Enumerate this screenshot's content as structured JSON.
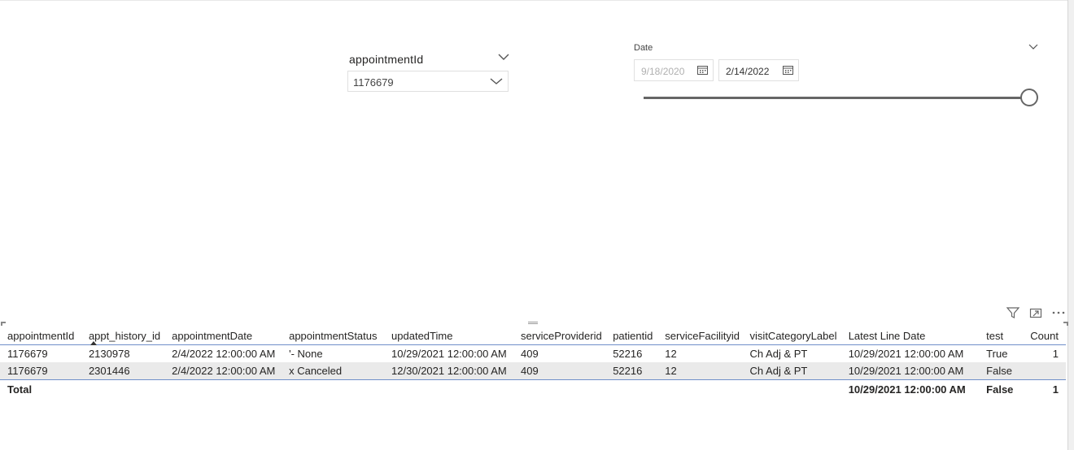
{
  "slicers": {
    "appointment": {
      "title": "appointmentId",
      "selected": "1176679"
    },
    "date": {
      "title": "Date",
      "start": "9/18/2020",
      "end": "2/14/2022"
    }
  },
  "table": {
    "headers": [
      "appointmentId",
      "appt_history_id",
      "appointmentDate",
      "appointmentStatus",
      "updatedTime",
      "serviceProviderid",
      "patientid",
      "serviceFacilityid",
      "visitCategoryLabel",
      "Latest Line Date",
      "test",
      "Count"
    ],
    "rows": [
      [
        "1176679",
        "2130978",
        "2/4/2022 12:00:00 AM",
        "'- None",
        "10/29/2021 12:00:00 AM",
        "409",
        "52216",
        "12",
        "Ch Adj & PT",
        "10/29/2021 12:00:00 AM",
        "True",
        "1"
      ],
      [
        "1176679",
        "2301446",
        "2/4/2022 12:00:00 AM",
        "x Canceled",
        "12/30/2021 12:00:00 AM",
        "409",
        "52216",
        "12",
        "Ch Adj & PT",
        "10/29/2021 12:00:00 AM",
        "False",
        ""
      ]
    ],
    "total": {
      "label": "Total",
      "latest_line_date": "10/29/2021 12:00:00 AM",
      "test": "False",
      "count": "1"
    }
  },
  "icons": {
    "filter": "filter-icon",
    "focus": "focus-mode-icon",
    "more": "more-options-icon"
  }
}
